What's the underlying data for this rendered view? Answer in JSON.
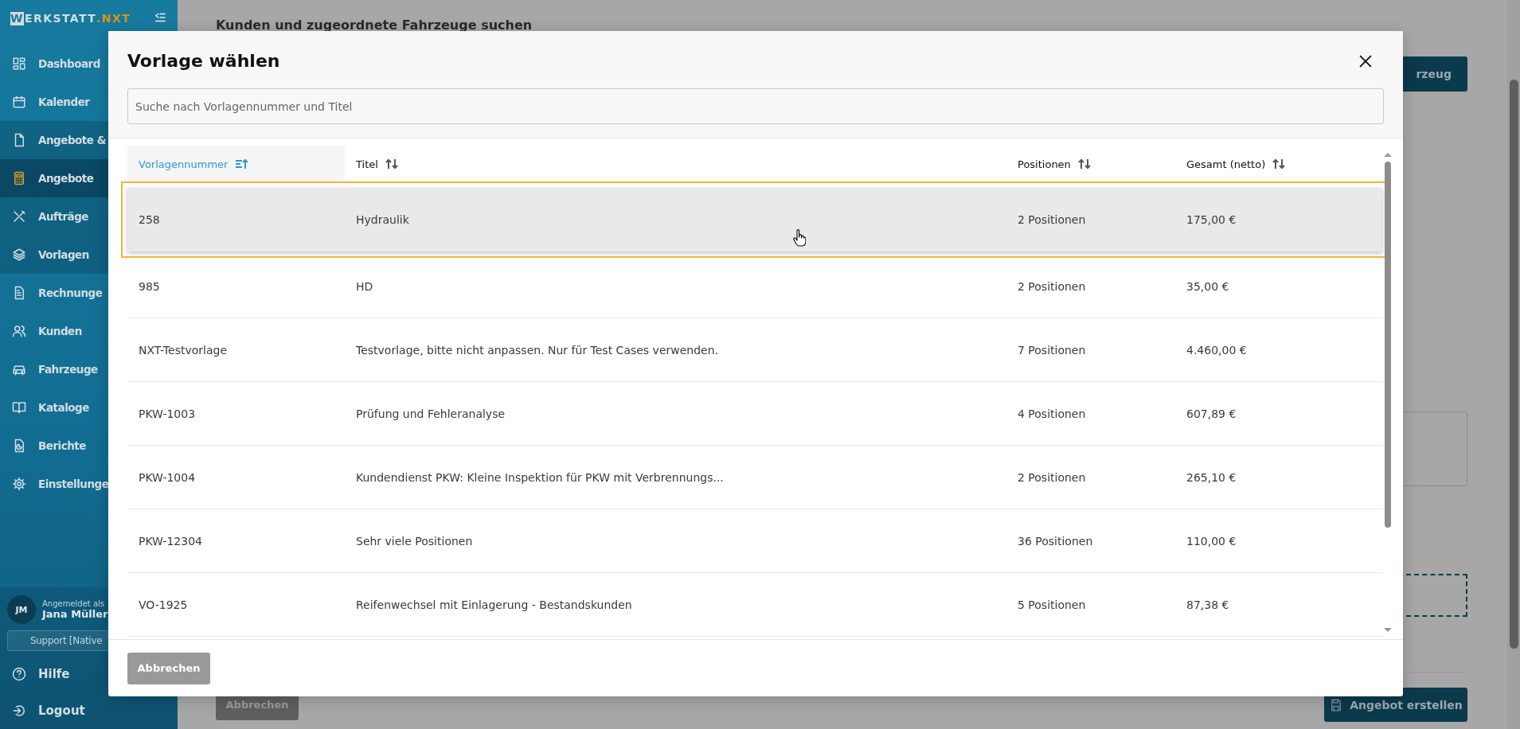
{
  "sidebar": {
    "logo": {
      "initial": "W",
      "name": "ERKSTATT",
      "suffix": ".NXT"
    },
    "items": [
      {
        "label": "Dashboard",
        "selected": false
      },
      {
        "label": "Kalender",
        "selected": false
      },
      {
        "label": "Angebote &",
        "selected": false,
        "expanded": true,
        "children": [
          {
            "label": "Angebote",
            "selected": true
          },
          {
            "label": "Aufträge",
            "selected": false
          },
          {
            "label": "Vorlagen",
            "selected": false
          }
        ]
      },
      {
        "label": "Rechnunge",
        "selected": false
      },
      {
        "label": "Kunden",
        "selected": false
      },
      {
        "label": "Fahrzeuge",
        "selected": false
      },
      {
        "label": "Kataloge",
        "selected": false
      },
      {
        "label": "Berichte",
        "selected": false
      },
      {
        "label": "Einstellunge",
        "selected": false
      }
    ],
    "user": {
      "initials": "JM",
      "caption": "Angemeldet als",
      "name": "Jana Müller",
      "tenant": "Support [Native"
    },
    "footer_links": [
      "Hilfe",
      "Logout"
    ]
  },
  "background": {
    "title": "Kunden und zugeordnete Fahrzeuge suchen",
    "vehicle_button": "rzeug",
    "cancel_button": "Abbrechen",
    "create_button": "Angebot erstellen"
  },
  "dialog": {
    "title": "Vorlage wählen",
    "search": {
      "placeholder": "Suche nach Vorlagennummer und Titel"
    },
    "table": {
      "columns": [
        {
          "label": "Vorlagennummer",
          "sorted": true
        },
        {
          "label": "Titel",
          "sorted": false
        },
        {
          "label": "Positionen",
          "sorted": false
        },
        {
          "label": "Gesamt (netto)",
          "sorted": false
        }
      ],
      "rows": [
        {
          "cells": [
            "258",
            "Hydraulik",
            "2 Positionen",
            "175,00 €"
          ],
          "selected": true
        },
        {
          "cells": [
            "985",
            "HD",
            "2 Positionen",
            "35,00 €"
          ],
          "selected": false
        },
        {
          "cells": [
            "NXT-Testvorlage",
            "Testvorlage, bitte nicht anpassen. Nur für Test Cases verwenden.",
            "7 Positionen",
            "4.460,00 €"
          ],
          "selected": false
        },
        {
          "cells": [
            "PKW-1003",
            "Prüfung und Fehleranalyse",
            "4 Positionen",
            "607,89 €"
          ],
          "selected": false
        },
        {
          "cells": [
            "PKW-1004",
            "Kundendienst PKW: Kleine Inspektion für PKW mit Verbrennungs...",
            "2 Positionen",
            "265,10 €"
          ],
          "selected": false
        },
        {
          "cells": [
            "PKW-12304",
            "Sehr viele Positionen",
            "36 Positionen",
            "110,00 €"
          ],
          "selected": false
        },
        {
          "cells": [
            "VO-1925",
            "Reifenwechsel mit Einlagerung - Bestandskunden",
            "5 Positionen",
            "87,38 €"
          ],
          "selected": false
        }
      ]
    },
    "cancel_button": "Abbrechen"
  }
}
